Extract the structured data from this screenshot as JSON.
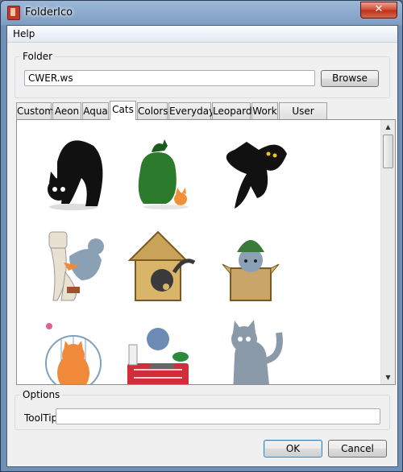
{
  "window": {
    "title": "FolderIco",
    "close_symbol": "✕"
  },
  "menu": {
    "items": [
      "Help"
    ]
  },
  "folder": {
    "label": "Folder",
    "value": "CWER.ws",
    "browse_label": "Browse"
  },
  "tabs": [
    {
      "label": "Custom",
      "active": false
    },
    {
      "label": "Aeon",
      "active": false
    },
    {
      "label": "Aqua",
      "active": false
    },
    {
      "label": "Cats",
      "active": true
    },
    {
      "label": "Colors",
      "active": false
    },
    {
      "label": "Everyday",
      "active": false
    },
    {
      "label": "Leopard",
      "active": false
    },
    {
      "label": "Work",
      "active": false
    },
    {
      "label": "User Icons",
      "active": false
    }
  ],
  "icons": [
    {
      "name": "black-cat-icon"
    },
    {
      "name": "green-bush-cat-icon"
    },
    {
      "name": "bat-cat-icon"
    },
    {
      "name": "toilet-cat-icon"
    },
    {
      "name": "doghouse-cat-icon"
    },
    {
      "name": "box-helmet-cat-icon"
    },
    {
      "name": "birdcage-cat-icon"
    },
    {
      "name": "shopping-basket-cat-icon"
    },
    {
      "name": "gray-cat-icon"
    }
  ],
  "scrollbar": {
    "up": "▲",
    "down": "▼"
  },
  "options": {
    "label": "Options",
    "tooltip_label": "ToolTip",
    "tooltip_value": ""
  },
  "buttons": {
    "ok": "OK",
    "cancel": "Cancel"
  }
}
